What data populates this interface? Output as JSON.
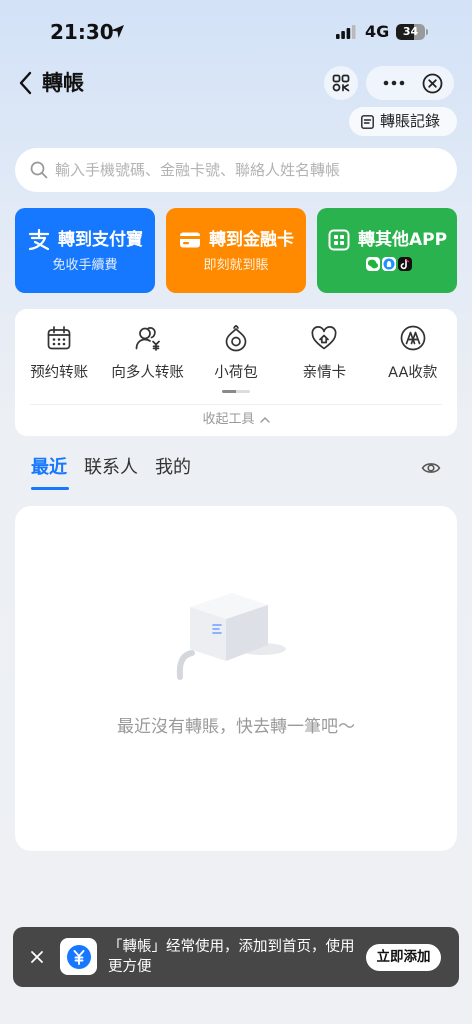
{
  "status_bar": {
    "time": "21:30",
    "network": "4G",
    "battery_level": "34"
  },
  "header": {
    "title": "轉帳",
    "records_label": "轉賬記錄"
  },
  "search": {
    "placeholder": "輸入手機號碼、金融卡號、聯絡人姓名轉帳"
  },
  "quick_actions": [
    {
      "title": "轉到支付寶",
      "subtitle": "免收手續費",
      "icon": "alipay-icon",
      "color": "#1677ff"
    },
    {
      "title": "轉到金融卡",
      "subtitle": "即刻就到賬",
      "icon": "bank-card-icon",
      "color": "#ff8a00"
    },
    {
      "title": "轉其他APP",
      "icon": "app-grid-icon",
      "color": "#2ab24e",
      "app_icons": [
        "wechat-icon",
        "qq-icon",
        "tiktok-icon"
      ]
    }
  ],
  "tools": {
    "items": [
      {
        "label": "预约转账",
        "icon": "calendar-icon"
      },
      {
        "label": "向多人转账",
        "icon": "multi-person-transfer-icon"
      },
      {
        "label": "小荷包",
        "icon": "purse-icon"
      },
      {
        "label": "亲情卡",
        "icon": "heart-card-icon"
      },
      {
        "label": "AA收款",
        "icon": "aa-collect-icon"
      }
    ],
    "collapse_label": "收起工具"
  },
  "tabs": [
    {
      "label": "最近",
      "active": true
    },
    {
      "label": "联系人",
      "active": false
    },
    {
      "label": "我的",
      "active": false
    }
  ],
  "empty_state": {
    "message": "最近沒有轉賬，快去轉一筆吧～",
    "illustration": "empty-box-illustration"
  },
  "toast": {
    "message": "「轉帳」经常使用，添加到首页，使用更方便",
    "action_label": "立即添加",
    "icon": "yuan-icon"
  },
  "colors": {
    "accent": "#1677ff",
    "toast_bg": "#474747",
    "text_muted": "#9a9a9a"
  }
}
